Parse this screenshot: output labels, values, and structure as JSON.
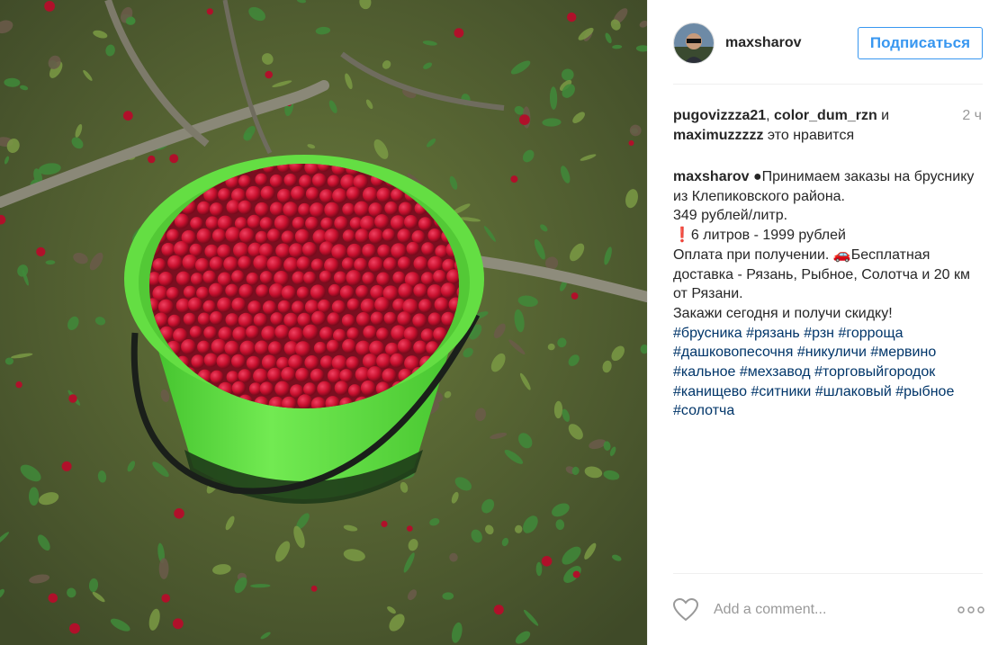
{
  "post": {
    "author": "maxsharov",
    "follow_label": "Подписаться",
    "likes": {
      "user1": "pugovizzza21",
      "sep": ", ",
      "user2": "color_dum_rzn",
      "and": " и",
      "user3": "maximuzzzzz",
      "suffix": " это нравится"
    },
    "time": "2 ч",
    "caption": {
      "author": "maxsharov",
      "text": " ●Принимаем заказы на бруснику из Клепиковского района.\n349 рублей/литр.\n❗6 литров - 1999 рублей\nОплата при получении. 🚗Бесплатная доставка - Рязань, Рыбное, Солотча и 20 км от Рязани.\nЗакажи сегодня и получи скидку!"
    },
    "hashtags": [
      "#брусника",
      "#рязань",
      "#рзн",
      "#горроща",
      "#дашковопесочня",
      "#никуличи",
      "#мервино",
      "#кальное",
      "#мехзавод",
      "#торговыйгородок",
      "#канищево",
      "#ситники",
      "#шлаковый",
      "#рыбное",
      "#солотча"
    ],
    "comment_placeholder": "Add a comment..."
  },
  "colors": {
    "accent": "#3897f0",
    "hashtag": "#003569",
    "bucket": "#6be34b",
    "berry": "#c8102e"
  },
  "icons": {
    "like": "heart-icon",
    "options": "more-options-icon"
  }
}
